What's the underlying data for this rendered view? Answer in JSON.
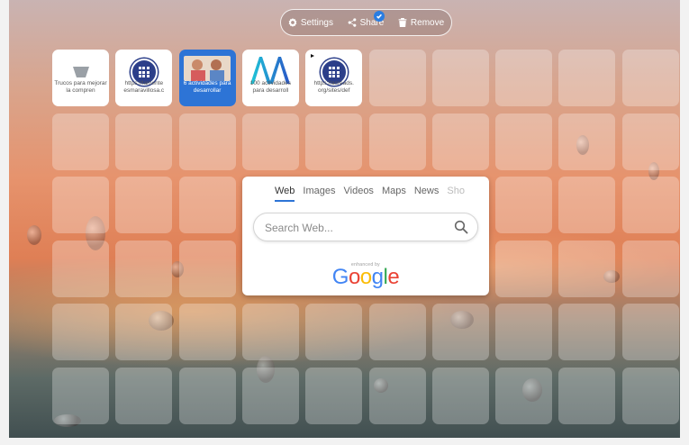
{
  "toolbar": {
    "settings_label": "Settings",
    "share_label": "Share",
    "remove_label": "Remove",
    "share_checked": true
  },
  "tiles": [
    {
      "label": "Trucos para mejorar la compren",
      "icon": "funnel-icon"
    },
    {
      "label": "https://lamente esmaravillosa.c",
      "icon": "globe-icon"
    },
    {
      "label": "6 actividades para desarrollar",
      "icon": "thumbnail-image"
    },
    {
      "label": "100 actividades para desarroll",
      "icon": "aa-logo-icon"
    },
    {
      "label": "https://acreads. org/sites/def",
      "icon": "globe-icon"
    }
  ],
  "search": {
    "tabs": [
      "Web",
      "Images",
      "Videos",
      "Maps",
      "News",
      "Sho"
    ],
    "active_tab": "Web",
    "placeholder": "Search Web...",
    "value": "",
    "enhanced_by": "enhanced by",
    "brand": "Google"
  },
  "colors": {
    "accent": "#2d74d6",
    "google_blue": "#4285f4",
    "google_red": "#ea4335",
    "google_yellow": "#fbbc05",
    "google_green": "#34a853"
  }
}
